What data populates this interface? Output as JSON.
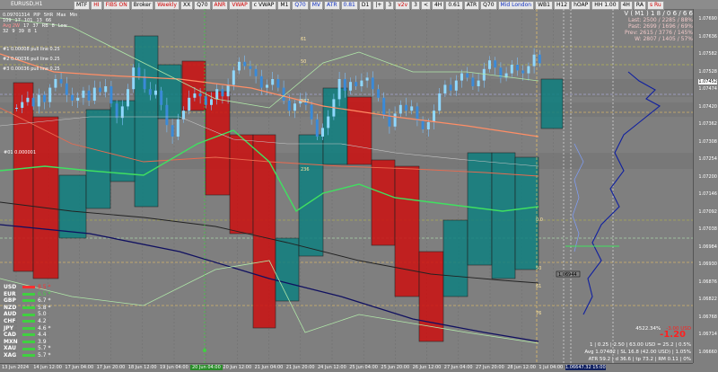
{
  "window": {
    "title": "EURUSD,H1"
  },
  "toolbar": {
    "buttons": [
      {
        "label": "MTF",
        "color": "normal"
      },
      {
        "label": "HI",
        "color": "red"
      },
      {
        "label": "FIBS ON",
        "color": "red"
      },
      {
        "label": "Broker",
        "color": "normal"
      },
      {
        "label": "Weekly",
        "color": "red"
      },
      {
        "label": "XX",
        "color": "normal"
      },
      {
        "label": "Q70",
        "color": "normal"
      },
      {
        "label": "ANR",
        "color": "red"
      },
      {
        "label": "VWAP",
        "color": "red"
      },
      {
        "label": "c VWAP",
        "color": "normal"
      },
      {
        "label": "M1",
        "color": "normal"
      },
      {
        "label": "Q70",
        "color": "blue"
      },
      {
        "label": "MV",
        "color": "blue"
      },
      {
        "label": "ATR",
        "color": "blue"
      },
      {
        "label": "0.81",
        "color": "blue"
      },
      {
        "label": "D1",
        "color": "normal"
      },
      {
        "label": "|+",
        "color": "normal"
      },
      {
        "label": "3",
        "color": "normal"
      },
      {
        "label": "v2v",
        "color": "red"
      },
      {
        "label": "3",
        "color": "normal"
      },
      {
        "label": "<",
        "color": "normal"
      },
      {
        "label": "4H",
        "color": "normal"
      },
      {
        "label": "0.61",
        "color": "normal"
      },
      {
        "label": "ATR",
        "color": "normal"
      },
      {
        "label": "Q70",
        "color": "normal"
      },
      {
        "label": "Mid London",
        "color": "blue"
      },
      {
        "label": "WB1",
        "color": "normal"
      },
      {
        "label": "H12",
        "color": "normal"
      },
      {
        "label": "hOAP",
        "color": "normal"
      },
      {
        "label": "HH 1.00",
        "color": "normal"
      },
      {
        "label": "4H",
        "color": "normal"
      },
      {
        "label": "RA",
        "color": "normal"
      },
      {
        "label": "s Ru",
        "color": "red"
      }
    ]
  },
  "info_panel": {
    "rows": [
      [
        "0.09701314",
        "PIP",
        "5HR",
        "Max",
        "Min"
      ],
      [
        "109",
        "17",
        "101",
        "13",
        "66"
      ],
      [
        "Avg 2W",
        "17",
        "37",
        "RB",
        "8",
        "Low"
      ],
      [
        "32",
        "9",
        "39",
        "8",
        "1"
      ]
    ]
  },
  "ma_labels": [
    "#1 0.00008 pull line 0.25",
    "#2 0.00036 pull line 0.25",
    "#3 0.00036 pull line 0.25"
  ],
  "left_marker": "#01 0.000001",
  "strength": {
    "items": [
      {
        "cur": "USD",
        "val": "8.5 *",
        "color": "#ff3030"
      },
      {
        "cur": "EUR",
        "val": "6.5 *",
        "color": "#40d040"
      },
      {
        "cur": "GBP",
        "val": "6.7 *",
        "color": "#ffffff"
      },
      {
        "cur": "NZD",
        "val": "5.8 *",
        "color": "#ffffff"
      },
      {
        "cur": "AUD",
        "val": "5.0",
        "color": "#ffffff"
      },
      {
        "cur": "CHF",
        "val": "4.2",
        "color": "#ffffff"
      },
      {
        "cur": "JPY",
        "val": "4.6 *",
        "color": "#ffffff"
      },
      {
        "cur": "CAD",
        "val": "4.4",
        "color": "#ffffff"
      },
      {
        "cur": "MXN",
        "val": "3.9",
        "color": "#ffffff"
      },
      {
        "cur": "XAU",
        "val": "5.7 *",
        "color": "#ffffff"
      },
      {
        "cur": "XAG",
        "val": "5.7 *",
        "color": "#ffffff"
      }
    ]
  },
  "vpanel": {
    "title": "V ( M1 ) 1 8 / 0 6 / 6 6",
    "lines": [
      "Last: 2500 / 2285 / 88%",
      "Past: 2699 / 1696 / 69%",
      "Prev: 2615 / 3776 / 145%",
      "W: 2807 / 1405 / 57%"
    ]
  },
  "bottom_stats": {
    "profit": "4522.34%",
    "profit_neg": "-3.00 USD",
    "big": "-1.20",
    "line1": "1 | 0.25 | 2.50 | 63.00 USD = 25.2 | 0.5%",
    "line2": "Avg 1.07482 | SL 16.8 (42.00 USD) | 1.05%",
    "line3": "ATR 59.2 | d 36.6 | tp 73.2 | RM 0.11 | 0%"
  },
  "price_labels": [
    "1.07690",
    "1.07636",
    "1.07582",
    "1.07528",
    "1.07474",
    "1.07420",
    "1.07362",
    "1.07308",
    "1.07254",
    "1.07200",
    "1.07146",
    "1.07092",
    "1.07038",
    "1.06984",
    "1.06930",
    "1.06876",
    "1.06822",
    "1.06768",
    "1.06714",
    "1.06660"
  ],
  "time_labels": [
    "13 Jun 2024",
    "14 Jun 12:00",
    "17 Jun 04:00",
    "17 Jun 20:00",
    "18 Jun 12:00",
    "19 Jun 04:00",
    "19 Jun 20:00",
    "20 Jun 12:00",
    "21 Jun 04:00",
    "21 Jun 20:00",
    "24 Jun 12:00",
    "25 Jun 04:00",
    "25 Jun 20:00",
    "26 Jun 12:00",
    "27 Jun 04:00",
    "27 Jun 20:00",
    "28 Jun 12:00",
    "1 Jul 04:00"
  ],
  "time_highlight": "20 Jun 04:00",
  "price_tag_current": "1.07452",
  "price_tag_marker": "1.06944",
  "price_tag_bottom": "1.06647.32 15:00",
  "fib_labels": [
    "61",
    "50",
    "382",
    "236",
    "0.0",
    "50",
    "61",
    "76"
  ],
  "colors": {
    "bull": "#0f7f7f",
    "bear": "#cc1010",
    "ema_green": "#40e060",
    "ema_orange": "#ff8050",
    "blue_line": "#101040",
    "dark_line": "#222222"
  }
}
